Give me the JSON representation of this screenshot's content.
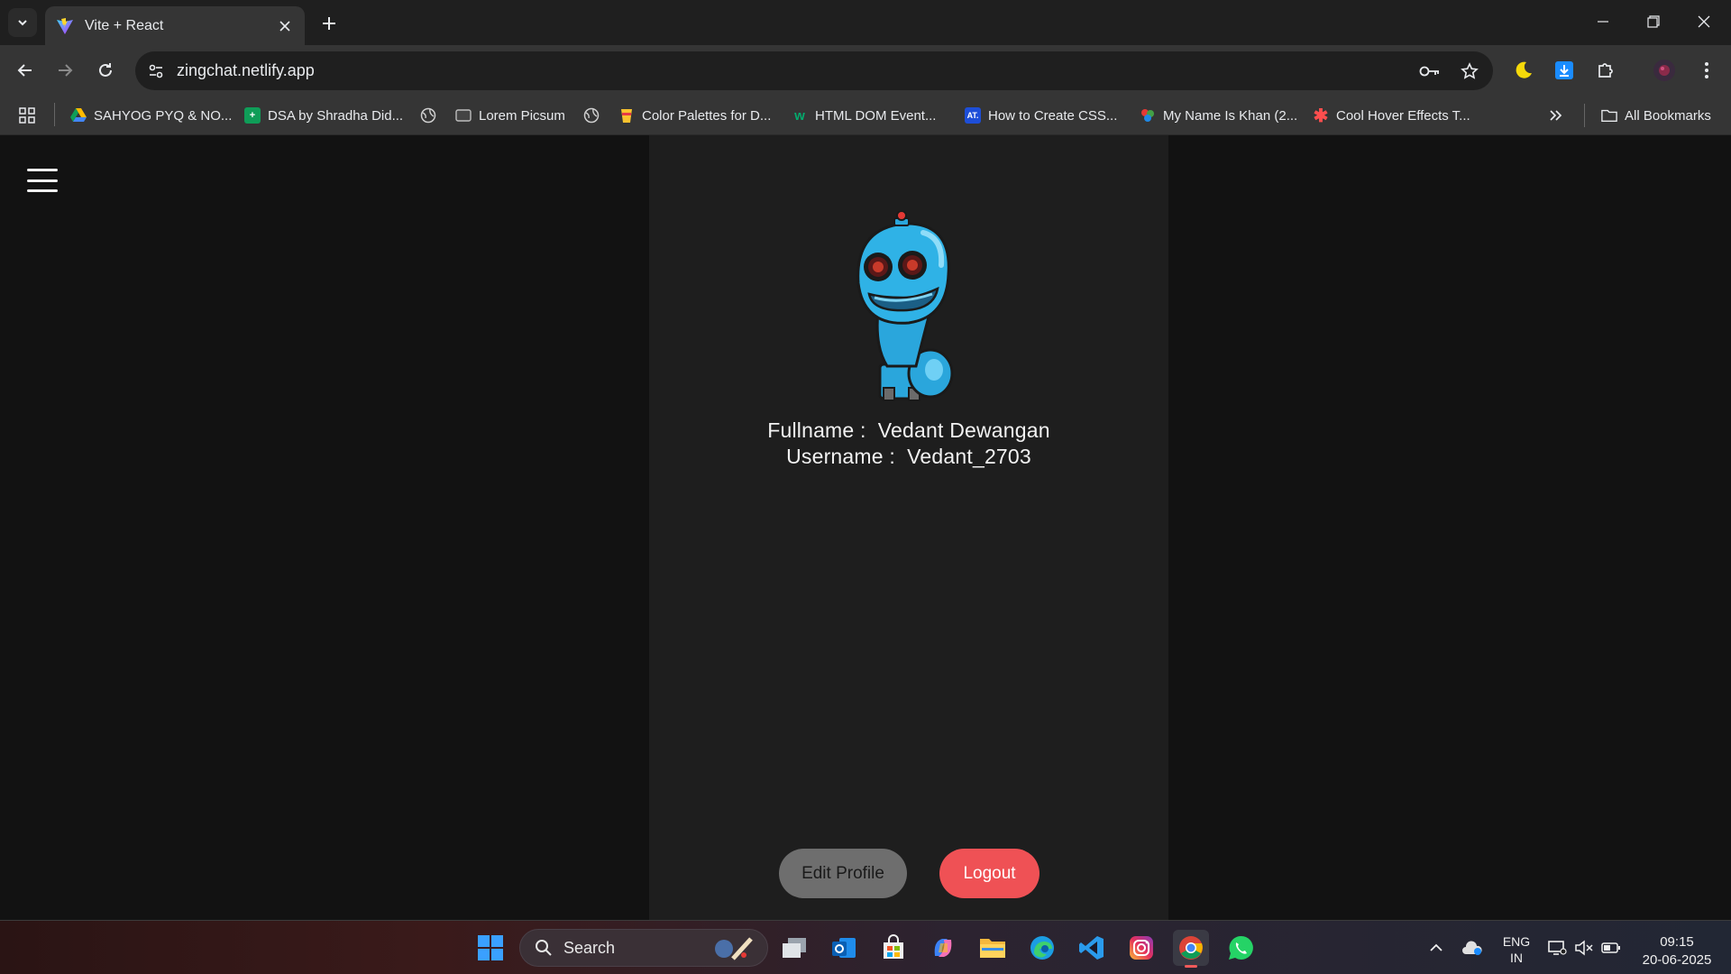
{
  "browser": {
    "tab_title": "Vite + React",
    "url": "zingchat.netlify.app",
    "bookmarks": [
      {
        "label": "SAHYOG PYQ & NO...",
        "icon": "google-drive-icon"
      },
      {
        "label": "DSA by Shradha Did...",
        "icon": "sheets-icon"
      },
      {
        "label": "",
        "icon": "globe-icon"
      },
      {
        "label": "Lorem Picsum",
        "icon": "picsum-icon"
      },
      {
        "label": "",
        "icon": "globe-icon"
      },
      {
        "label": "Color Palettes for D...",
        "icon": "palette-icon"
      },
      {
        "label": "HTML DOM Event...",
        "icon": "w3schools-icon"
      },
      {
        "label": "How to Create CSS...",
        "icon": "atatus-icon"
      },
      {
        "label": "My Name Is Khan (2...",
        "icon": "movie-icon"
      },
      {
        "label": "Cool Hover Effects T...",
        "icon": "asterisk-icon"
      }
    ],
    "all_bookmarks_label": "All Bookmarks"
  },
  "profile": {
    "fullname_label": "Fullname :",
    "fullname": "Vedant Dewangan",
    "username_label": "Username :",
    "username": "Vedant_2703",
    "edit_label": "Edit Profile",
    "logout_label": "Logout"
  },
  "colors": {
    "logout": "#ef5155",
    "edit": "#6e6e6e",
    "panel": "#1e1e1e",
    "background": "#121212"
  },
  "taskbar": {
    "search_label": "Search",
    "lang_line1": "ENG",
    "lang_line2": "IN",
    "time": "09:15",
    "date": "20-06-2025"
  }
}
